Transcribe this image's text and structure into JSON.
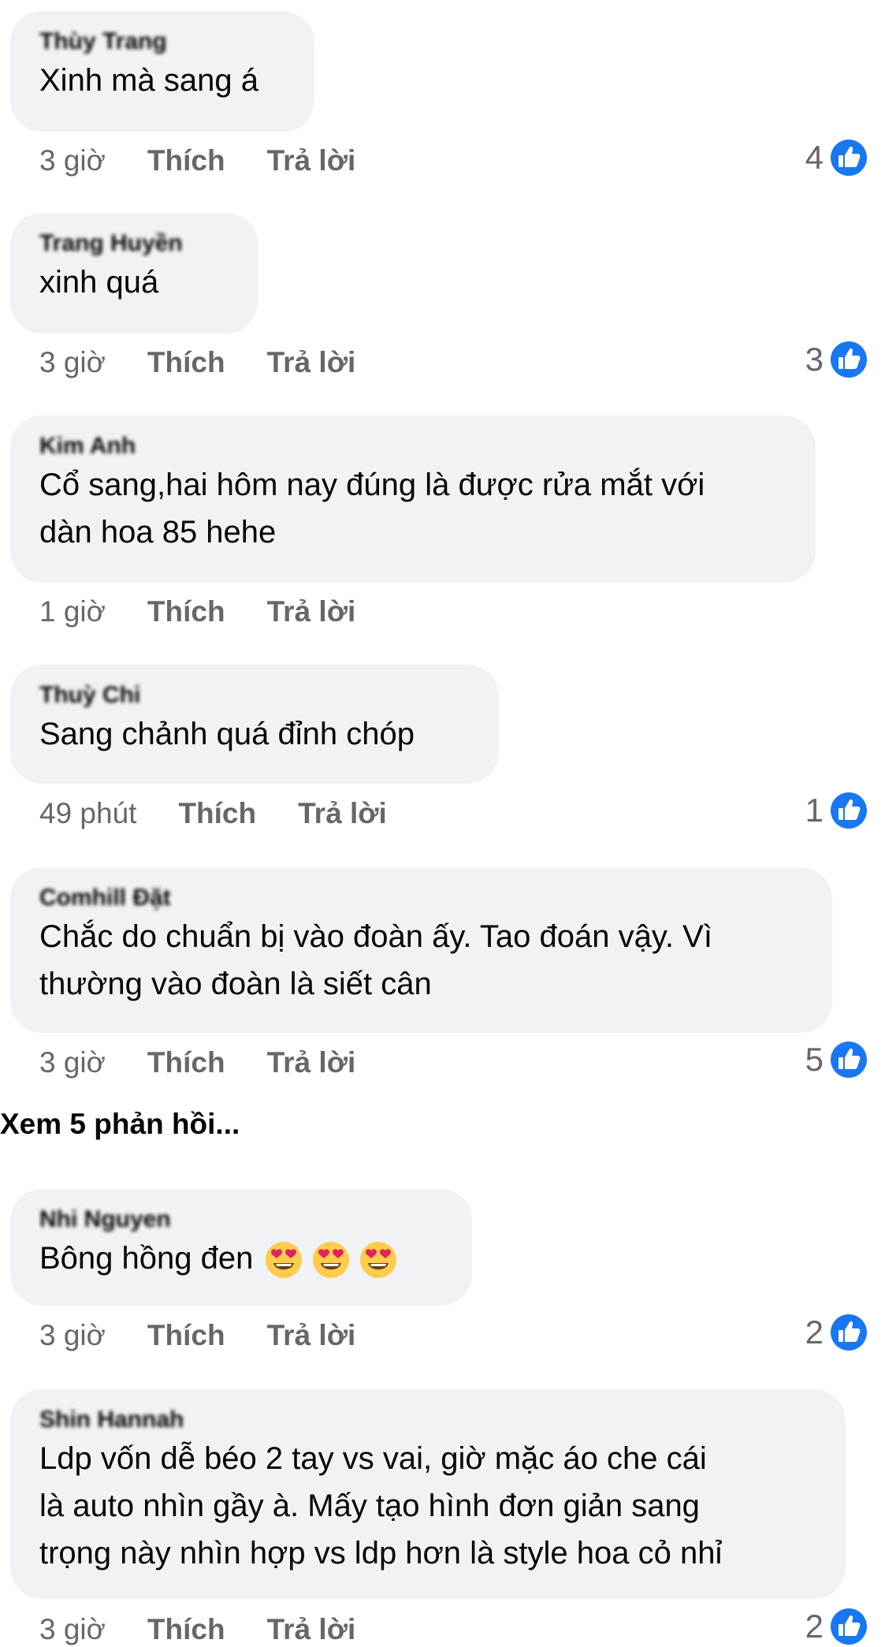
{
  "accent_color": "#1877f2",
  "bubble_color": "#f0f2f5",
  "comments": [
    {
      "author": "Thùy Trang",
      "text": "Xinh mà sang á",
      "time": "3 giờ",
      "like": "Thích",
      "reply": "Trả lời",
      "reactions": "4"
    },
    {
      "author": "Trang Huyền",
      "text": "xinh quá",
      "time": "3 giờ",
      "like": "Thích",
      "reply": "Trả lời",
      "reactions": "3"
    },
    {
      "author": "Kim Anh",
      "text_lines": [
        "Cổ sang,hai hôm nay đúng là được rửa mắt với",
        "dàn hoa 85 hehe"
      ],
      "time": "1 giờ",
      "like": "Thích",
      "reply": "Trả lời"
    },
    {
      "author": "Thuỳ Chi",
      "text": "Sang chảnh quá đỉnh chóp",
      "time": "49 phút",
      "like": "Thích",
      "reply": "Trả lời",
      "reactions": "1"
    },
    {
      "author": "Comhill Đặt",
      "text_lines": [
        "Chắc do chuẩn bị vào đoàn ấy. Tao đoán vậy. Vì",
        "thường vào đoàn là siết cân"
      ],
      "time": "3 giờ",
      "like": "Thích",
      "reply": "Trả lời",
      "reactions": "5"
    },
    {
      "author": "Nhi Nguyen",
      "text": "Bông hồng đen",
      "emojis": [
        "heart-eyes-emoji",
        "heart-eyes-emoji",
        "heart-eyes-emoji"
      ],
      "time": "3 giờ",
      "like": "Thích",
      "reply": "Trả lời",
      "reactions": "2"
    },
    {
      "author": "Shin Hannah",
      "text_lines": [
        "Ldp vốn dễ béo 2 tay vs vai, giờ mặc áo che cái",
        "là auto nhìn gầy à. Mấy tạo hình đơn giản sang",
        "trọng này nhìn hợp vs ldp hơn là style hoa cỏ nhỉ"
      ],
      "time": "3 giờ",
      "like": "Thích",
      "reply": "Trả lời",
      "reactions": "2"
    }
  ],
  "view_more_replies": "Xem 5 phản hồi..."
}
